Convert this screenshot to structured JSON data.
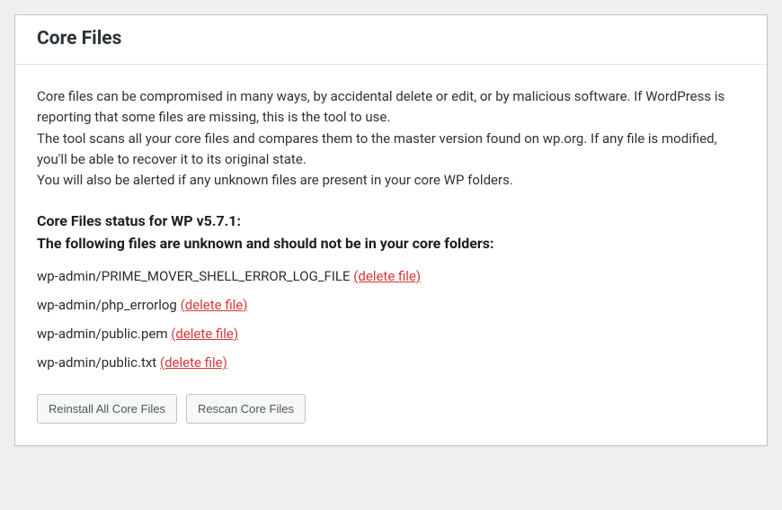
{
  "panel": {
    "title": "Core Files",
    "description_line1": "Core files can be compromised in many ways, by accidental delete or edit, or by malicious software. If WordPress is reporting that some files are missing, this is the tool to use.",
    "description_line2": "The tool scans all your core files and compares them to the master version found on wp.org. If any file is modified, you'll be able to recover it to its original state.",
    "description_line3": "You will also be alerted if any unknown files are present in your core WP folders.",
    "status_heading_line1": "Core Files status for WP v5.7.1:",
    "status_heading_line2": "The following files are unknown and should not be in your core folders:",
    "files": [
      {
        "path": "wp-admin/PRIME_MOVER_SHELL_ERROR_LOG_FILE",
        "action_label": "(delete file)"
      },
      {
        "path": "wp-admin/php_errorlog",
        "action_label": "(delete file)"
      },
      {
        "path": "wp-admin/public.pem",
        "action_label": "(delete file)"
      },
      {
        "path": "wp-admin/public.txt",
        "action_label": "(delete file)"
      }
    ],
    "buttons": {
      "reinstall": "Reinstall All Core Files",
      "rescan": "Rescan Core Files"
    }
  }
}
